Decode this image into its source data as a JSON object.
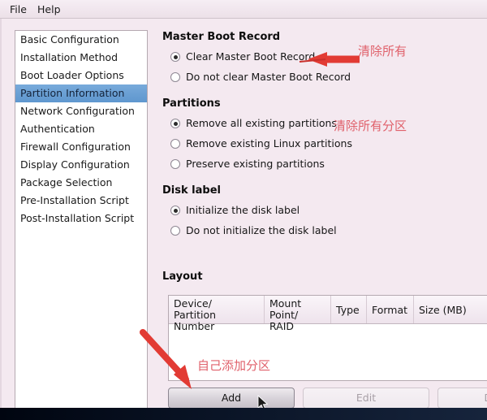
{
  "menubar": {
    "items": [
      {
        "label": "File",
        "name": "menu-file"
      },
      {
        "label": "Help",
        "name": "menu-help"
      }
    ]
  },
  "sidebar": {
    "items": [
      {
        "label": "Basic Configuration",
        "selected": false
      },
      {
        "label": "Installation Method",
        "selected": false
      },
      {
        "label": "Boot Loader Options",
        "selected": false
      },
      {
        "label": "Partition Information",
        "selected": true
      },
      {
        "label": "Network Configuration",
        "selected": false
      },
      {
        "label": "Authentication",
        "selected": false
      },
      {
        "label": "Firewall Configuration",
        "selected": false
      },
      {
        "label": "Display Configuration",
        "selected": false
      },
      {
        "label": "Package Selection",
        "selected": false
      },
      {
        "label": "Pre-Installation Script",
        "selected": false
      },
      {
        "label": "Post-Installation Script",
        "selected": false
      }
    ]
  },
  "main": {
    "mbr": {
      "heading": "Master Boot Record",
      "options": [
        {
          "label": "Clear Master Boot Record",
          "checked": true
        },
        {
          "label": "Do not clear Master Boot Record",
          "checked": false
        }
      ]
    },
    "partitions": {
      "heading": "Partitions",
      "options": [
        {
          "label": "Remove all existing partitions",
          "checked": true
        },
        {
          "label": "Remove existing Linux partitions",
          "checked": false
        },
        {
          "label": "Preserve existing partitions",
          "checked": false
        }
      ]
    },
    "disk_label": {
      "heading": "Disk label",
      "options": [
        {
          "label": "Initialize the disk label",
          "checked": true
        },
        {
          "label": "Do not initialize the disk label",
          "checked": false
        }
      ]
    },
    "layout": {
      "heading": "Layout",
      "columns": [
        "Device/\nPartition Number",
        "Mount Point/\nRAID",
        "Type",
        "Format",
        "Size (MB)"
      ],
      "rows": [],
      "buttons": [
        {
          "label": "Add",
          "enabled": true
        },
        {
          "label": "Edit",
          "enabled": false
        },
        {
          "label": "Delete",
          "enabled": false
        }
      ]
    }
  },
  "annotations": {
    "color": "#e0616b",
    "notes": [
      {
        "text": "清除所有",
        "target": "Clear Master Boot Record"
      },
      {
        "text": "清除所有分区",
        "target": "Remove all existing partitions"
      },
      {
        "text": "自己添加分区",
        "target": "Add"
      }
    ]
  }
}
